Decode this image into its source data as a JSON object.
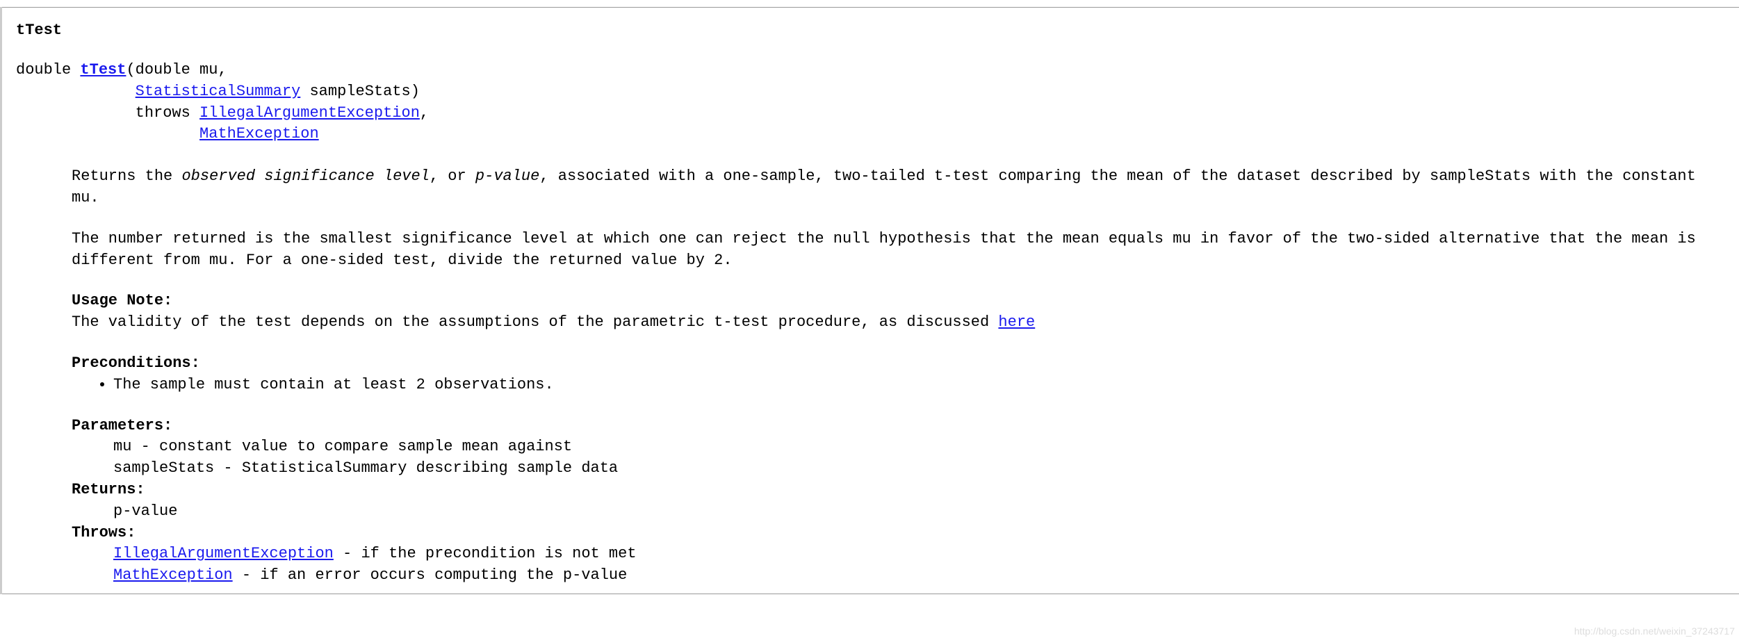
{
  "method": {
    "name": "tTest",
    "signature": {
      "return_type": "double ",
      "link_text": "tTest",
      "open": "(double mu,",
      "indent1": "             ",
      "param2_type_link": "StatisticalSummary",
      "param2_rest": " sampleStats)",
      "indent2": "             throws ",
      "ex1_link": "IllegalArgumentException",
      "comma": ",",
      "indent3": "                    ",
      "ex2_link": "MathException"
    },
    "doc": {
      "p1_a": "Returns the ",
      "p1_em1": "observed significance level",
      "p1_b": ", or ",
      "p1_em2": "p-value",
      "p1_c": ", associated with a one-sample, two-tailed t-test comparing the mean of the dataset described by sampleStats with the constant mu.",
      "p2": "The number returned is the smallest significance level at which one can reject the null hypothesis that the mean equals mu in favor of the two-sided alternative that the mean is different from mu. For a one-sided test, divide the returned value by 2.",
      "usage_label": "Usage Note:",
      "usage_text": "The validity of the test depends on the assumptions of the parametric t-test procedure, as discussed ",
      "usage_link": "here",
      "preconditions_label": "Preconditions:",
      "preconditions": [
        "The sample must contain at least 2 observations."
      ],
      "params_label": "Parameters:",
      "params": [
        {
          "name": "mu",
          "desc": " - constant value to compare sample mean against"
        },
        {
          "name": "sampleStats",
          "desc": " - StatisticalSummary describing sample data"
        }
      ],
      "returns_label": "Returns:",
      "returns": "p-value",
      "throws_label": "Throws:",
      "throws": [
        {
          "link": "IllegalArgumentException",
          "desc": " - if the precondition is not met"
        },
        {
          "link": "MathException",
          "desc": " - if an error occurs computing the p-value"
        }
      ]
    }
  },
  "watermark": "http://blog.csdn.net/weixin_37243717"
}
